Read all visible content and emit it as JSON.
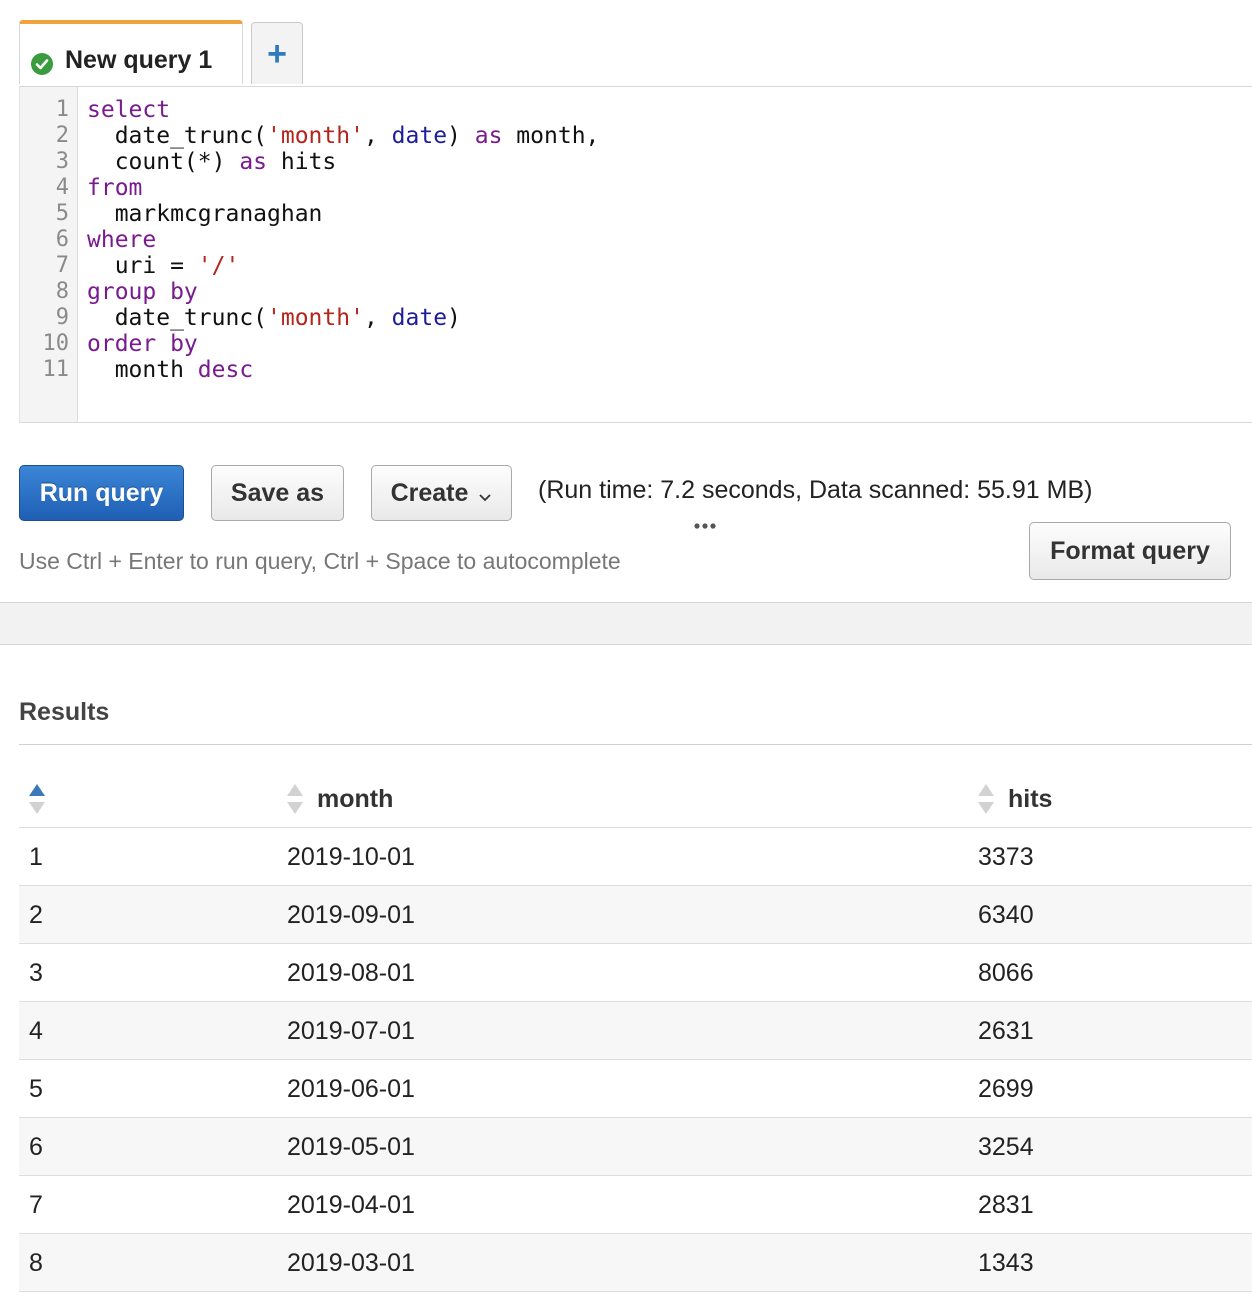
{
  "tabs": {
    "active_label": "New query 1",
    "add_label": "+"
  },
  "editor": {
    "line_numbers": [
      "1",
      "2",
      "3",
      "4",
      "5",
      "6",
      "7",
      "8",
      "9",
      "10",
      "11"
    ],
    "code": [
      [
        {
          "t": "select",
          "c": "kw"
        }
      ],
      [
        {
          "t": "  date_trunc(",
          "c": ""
        },
        {
          "t": "'month'",
          "c": "str"
        },
        {
          "t": ", ",
          "c": ""
        },
        {
          "t": "date",
          "c": "fn"
        },
        {
          "t": ") ",
          "c": ""
        },
        {
          "t": "as",
          "c": "kw"
        },
        {
          "t": " month,",
          "c": ""
        }
      ],
      [
        {
          "t": "  count(*) ",
          "c": ""
        },
        {
          "t": "as",
          "c": "kw"
        },
        {
          "t": " hits",
          "c": ""
        }
      ],
      [
        {
          "t": "from",
          "c": "kw"
        }
      ],
      [
        {
          "t": "  markmcgranaghan",
          "c": ""
        }
      ],
      [
        {
          "t": "where",
          "c": "kw"
        }
      ],
      [
        {
          "t": "  uri = ",
          "c": ""
        },
        {
          "t": "'/'",
          "c": "str"
        }
      ],
      [
        {
          "t": "group by",
          "c": "kw"
        }
      ],
      [
        {
          "t": "  date_trunc(",
          "c": ""
        },
        {
          "t": "'month'",
          "c": "str"
        },
        {
          "t": ", ",
          "c": ""
        },
        {
          "t": "date",
          "c": "fn"
        },
        {
          "t": ")",
          "c": ""
        }
      ],
      [
        {
          "t": "order by",
          "c": "kw"
        }
      ],
      [
        {
          "t": "  month ",
          "c": ""
        },
        {
          "t": "desc",
          "c": "kw"
        }
      ]
    ]
  },
  "toolbar": {
    "run_label": "Run query",
    "save_label": "Save as",
    "create_label": "Create",
    "run_info": "(Run time: 7.2 seconds, Data scanned: 55.91 MB)",
    "hint": "Use Ctrl + Enter to run query, Ctrl + Space to autocomplete",
    "format_label": "Format query"
  },
  "results": {
    "title": "Results",
    "columns": [
      "month",
      "hits"
    ],
    "rows": [
      {
        "n": "1",
        "month": "2019-10-01",
        "hits": "3373"
      },
      {
        "n": "2",
        "month": "2019-09-01",
        "hits": "6340"
      },
      {
        "n": "3",
        "month": "2019-08-01",
        "hits": "8066"
      },
      {
        "n": "4",
        "month": "2019-07-01",
        "hits": "2631"
      },
      {
        "n": "5",
        "month": "2019-06-01",
        "hits": "2699"
      },
      {
        "n": "6",
        "month": "2019-05-01",
        "hits": "3254"
      },
      {
        "n": "7",
        "month": "2019-04-01",
        "hits": "2831"
      },
      {
        "n": "8",
        "month": "2019-03-01",
        "hits": "1343"
      }
    ]
  },
  "colors": {
    "accent_tab": "#f0a33a",
    "run_button": "#2b6fc4",
    "success": "#3b9c3f"
  }
}
